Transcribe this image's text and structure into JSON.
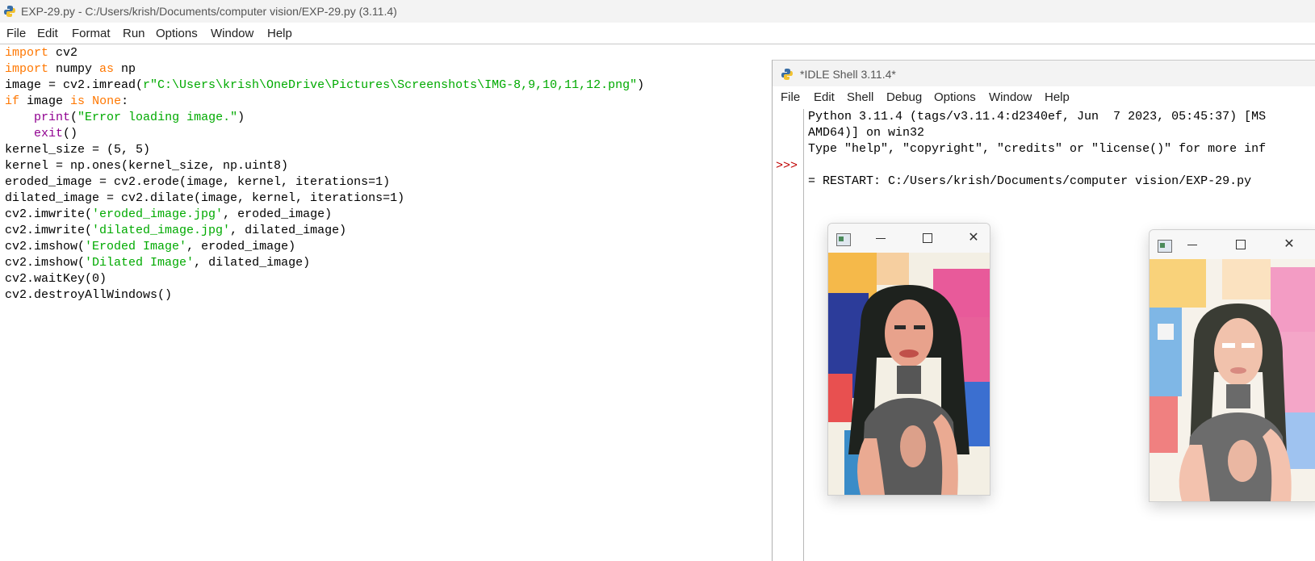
{
  "editor": {
    "window_title": "EXP-29.py - C:/Users/krish/Documents/computer vision/EXP-29.py (3.11.4)",
    "menu": [
      "File",
      "Edit",
      "Format",
      "Run",
      "Options",
      "Window",
      "Help"
    ],
    "code_lines": [
      [
        {
          "t": "import",
          "c": "kw"
        },
        {
          "t": " cv2"
        }
      ],
      [
        {
          "t": "import",
          "c": "kw"
        },
        {
          "t": " numpy "
        },
        {
          "t": "as",
          "c": "kw"
        },
        {
          "t": " np"
        }
      ],
      [
        {
          "t": "image = cv2.imread("
        },
        {
          "t": "r\"C:\\Users\\krish\\OneDrive\\Pictures\\Screenshots\\IMG-8,9,10,11,12.png\"",
          "c": "st"
        },
        {
          "t": ")"
        }
      ],
      [
        {
          "t": "if",
          "c": "kw"
        },
        {
          "t": " image "
        },
        {
          "t": "is",
          "c": "kw"
        },
        {
          "t": " "
        },
        {
          "t": "None",
          "c": "kw"
        },
        {
          "t": ":"
        }
      ],
      [
        {
          "t": "    "
        },
        {
          "t": "print",
          "c": "bi"
        },
        {
          "t": "("
        },
        {
          "t": "\"Error loading image.\"",
          "c": "st"
        },
        {
          "t": ")"
        }
      ],
      [
        {
          "t": "    "
        },
        {
          "t": "exit",
          "c": "bi"
        },
        {
          "t": "()"
        }
      ],
      [
        {
          "t": "kernel_size = (5, 5)"
        }
      ],
      [
        {
          "t": "kernel = np.ones(kernel_size, np.uint8)"
        }
      ],
      [
        {
          "t": "eroded_image = cv2.erode(image, kernel, iterations=1)"
        }
      ],
      [
        {
          "t": "dilated_image = cv2.dilate(image, kernel, iterations=1)"
        }
      ],
      [
        {
          "t": "cv2.imwrite("
        },
        {
          "t": "'eroded_image.jpg'",
          "c": "st"
        },
        {
          "t": ", eroded_image)"
        }
      ],
      [
        {
          "t": "cv2.imwrite("
        },
        {
          "t": "'dilated_image.jpg'",
          "c": "st"
        },
        {
          "t": ", dilated_image)"
        }
      ],
      [
        {
          "t": "cv2.imshow("
        },
        {
          "t": "'Eroded Image'",
          "c": "st"
        },
        {
          "t": ", eroded_image)"
        }
      ],
      [
        {
          "t": "cv2.imshow("
        },
        {
          "t": "'Dilated Image'",
          "c": "st"
        },
        {
          "t": ", dilated_image)"
        }
      ],
      [
        {
          "t": "cv2.waitKey(0)"
        }
      ],
      [
        {
          "t": "cv2.destroyAllWindows()"
        }
      ]
    ]
  },
  "shell": {
    "window_title": "*IDLE Shell 3.11.4*",
    "menu": [
      "File",
      "Edit",
      "Shell",
      "Debug",
      "Options",
      "Window",
      "Help"
    ],
    "prompt": ">>>",
    "lines": [
      "Python 3.11.4 (tags/v3.11.4:d2340ef, Jun  7 2023, 05:45:37) [MS",
      "AMD64)] on win32",
      "Type \"help\", \"copyright\", \"credits\" or \"license()\" for more inf",
      "",
      "= RESTART: C:/Users/krish/Documents/computer vision/EXP-29.py"
    ]
  },
  "image_windows": [
    {
      "name": "eroded-image-window",
      "controls": [
        "✕"
      ]
    },
    {
      "name": "dilated-image-window",
      "controls": [
        "✕"
      ]
    }
  ]
}
